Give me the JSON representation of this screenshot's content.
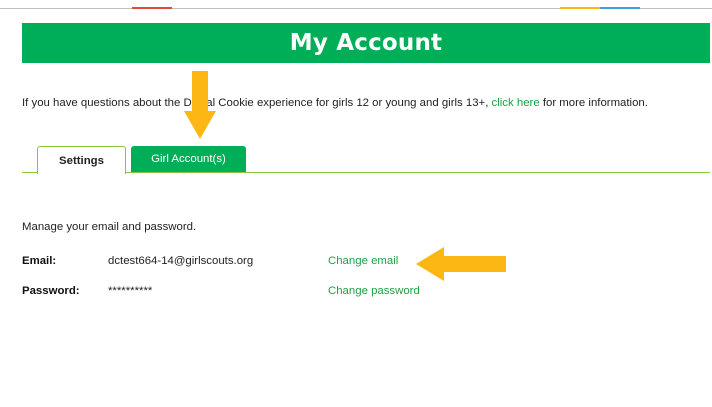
{
  "header": {
    "title": "My Account"
  },
  "intro": {
    "text_before": "If you have questions about the",
    "text_hidden": " Digital Cookie",
    "text_after": " experience for girls 12 or young and girls 13+, ",
    "link_label": "click here",
    "text_end": " for more information."
  },
  "tabs": [
    {
      "label": "Settings",
      "active": true
    },
    {
      "label": "Girl Account(s)",
      "active": false
    }
  ],
  "settings": {
    "manage_text": "Manage your email and password.",
    "email_label": "Email:",
    "email_value": "dctest664-14@girlscouts.org",
    "change_email_label": "Change email",
    "password_label": "Password:",
    "password_value": "**********",
    "change_password_label": "Change password"
  },
  "colors": {
    "brand_green": "#00ae58",
    "link_green": "#1fa046",
    "tab_border": "#8cc63f",
    "arrow": "#fdb714"
  },
  "icons": [
    "arrow-down-icon",
    "arrow-left-icon"
  ]
}
